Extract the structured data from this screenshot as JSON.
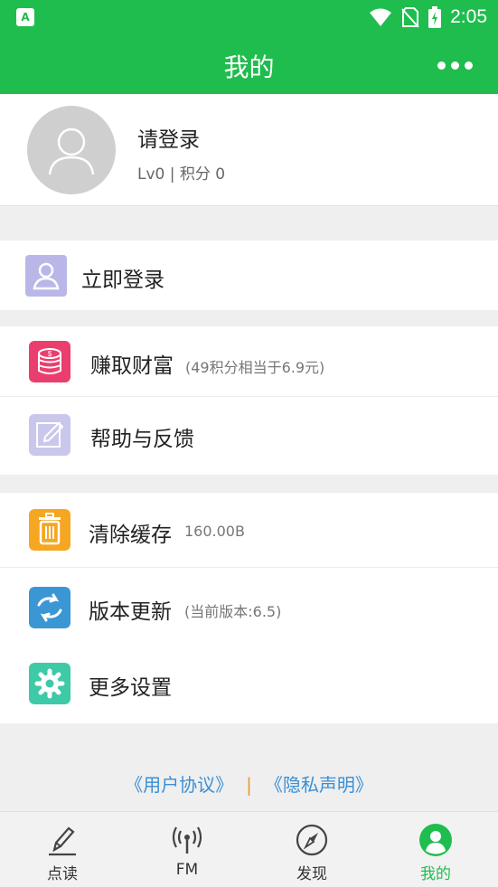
{
  "statusbar": {
    "app_badge": "A",
    "time": "2:05"
  },
  "header": {
    "title": "我的"
  },
  "profile": {
    "prompt": "请登录",
    "level_text": "Lv0 | 积分  0"
  },
  "login_row": {
    "label": "立即登录"
  },
  "menu_group1": [
    {
      "label": "赚取财富",
      "sub": "(49积分相当于6.9元)"
    },
    {
      "label": "帮助与反馈",
      "sub": ""
    }
  ],
  "menu_group2": [
    {
      "label": "清除缓存",
      "sub": "160.00B"
    },
    {
      "label": "版本更新",
      "sub": "(当前版本:6.5)"
    },
    {
      "label": "更多设置",
      "sub": ""
    }
  ],
  "footer_links": {
    "agreement": "《用户协议》",
    "separator": "|",
    "privacy": "《隐私声明》"
  },
  "tabs": [
    {
      "label": "点读",
      "icon": "pencil-icon"
    },
    {
      "label": "FM",
      "icon": "radio-icon"
    },
    {
      "label": "发现",
      "icon": "compass-icon"
    },
    {
      "label": "我的",
      "icon": "profile-icon",
      "active": true
    }
  ],
  "colors": {
    "brand_green": "#1fbd4e",
    "link_blue": "#3a8fd6",
    "separator_orange": "#e89a2e"
  }
}
